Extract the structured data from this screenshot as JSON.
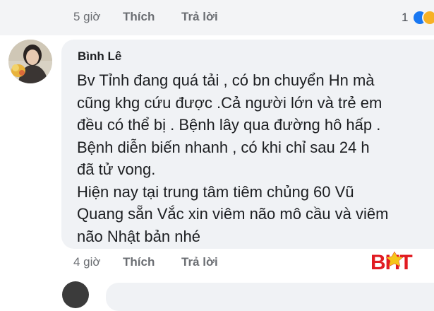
{
  "previous_comment": {
    "time": "5 giờ",
    "like_label": "Thích",
    "reply_label": "Trả lời",
    "reaction_count": "1",
    "reaction_icons": [
      "like-icon",
      "haha-icon"
    ]
  },
  "comment": {
    "author": "Bình Lê",
    "lines": [
      "Bv Tỉnh đang quá tải , có bn chuyển Hn mà",
      "cũng khg cứu được .Cả người lớn và trẻ em",
      "đều có thể bị . Bệnh lây qua đường hô hấp .",
      "Bệnh diễn biến nhanh , có khi chỉ sau 24 h",
      "đã tử vong.",
      "Hiện nay tại trung tâm tiêm chủng 60 Vũ",
      "Quang sẵn Vắc xin viêm não mô cầu và viêm",
      "não Nhật bản nhé"
    ],
    "time": "4 giờ",
    "like_label": "Thích",
    "reply_label": "Trả lời"
  },
  "watermark": {
    "text": "BHT",
    "color": "#e11b22"
  },
  "colors": {
    "bubble": "#f0f2f5",
    "meta_text": "#6b6e73",
    "like_reaction": "#1877f2",
    "haha_reaction": "#f7b125"
  }
}
